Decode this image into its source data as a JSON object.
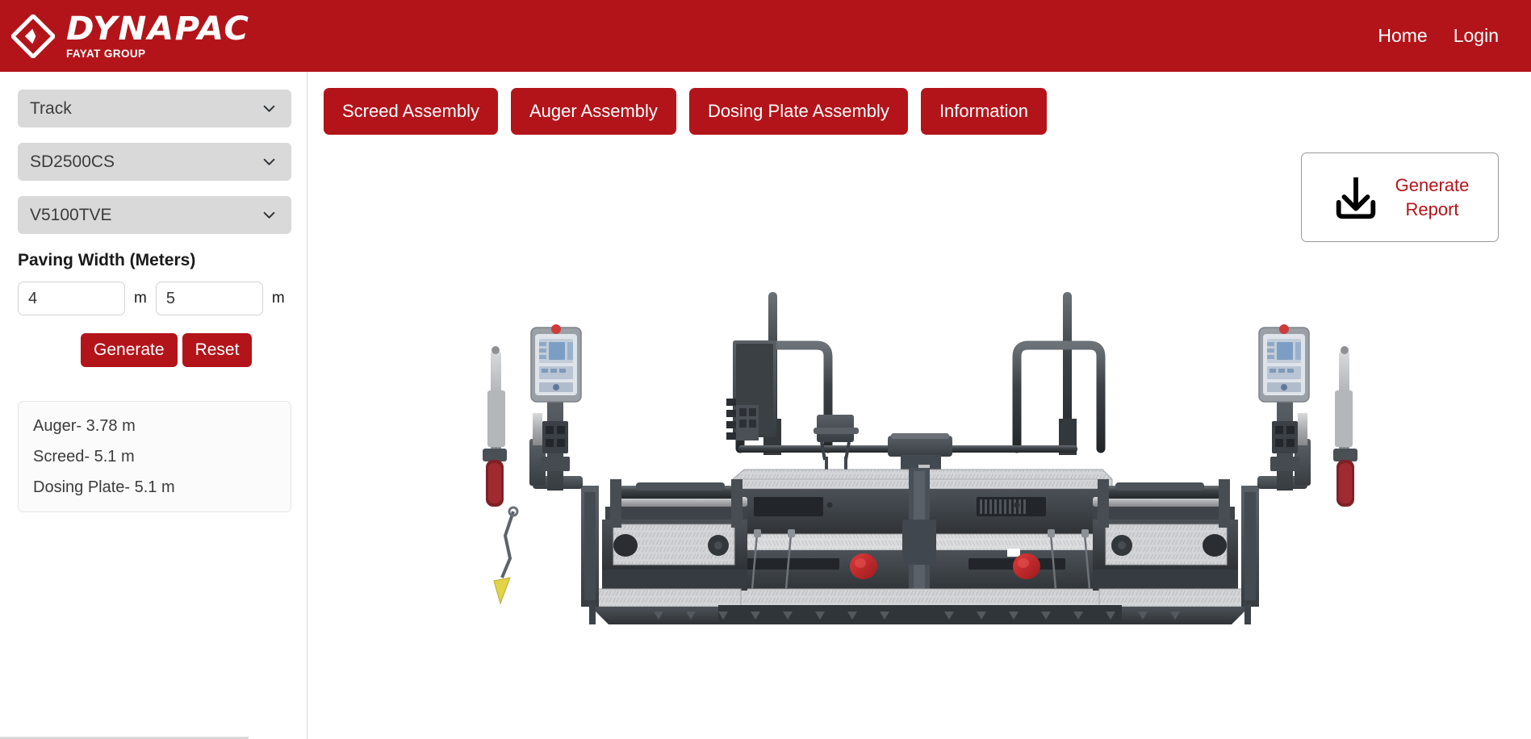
{
  "header": {
    "brand_name": "DYNAPAC",
    "brand_sub": "FAYAT GROUP",
    "brand_icon": "dynapac-diamond-logo",
    "nav": [
      {
        "label": "Home",
        "name": "nav-home"
      },
      {
        "label": "Login",
        "name": "nav-login"
      }
    ],
    "background_color": "#b3141a"
  },
  "sidebar": {
    "selects": [
      {
        "name": "machine-type-select",
        "value": "Track",
        "icon": "chevron-down-icon"
      },
      {
        "name": "machine-model-select",
        "value": "SD2500CS",
        "icon": "chevron-down-icon"
      },
      {
        "name": "screed-model-select",
        "value": "V5100TVE",
        "icon": "chevron-down-icon"
      }
    ],
    "paving_width": {
      "label": "Paving Width (Meters)",
      "left_value": "4",
      "left_unit": "m",
      "right_value": "5",
      "right_unit": "m",
      "placeholder": ""
    },
    "actions": {
      "generate_label": "Generate",
      "reset_label": "Reset"
    },
    "results": [
      "Auger- 3.78 m",
      "Screed- 5.1 m",
      "Dosing Plate- 5.1 m"
    ]
  },
  "main": {
    "tabs": [
      {
        "label": "Screed Assembly",
        "name": "tab-screed-assembly"
      },
      {
        "label": "Auger Assembly",
        "name": "tab-auger-assembly"
      },
      {
        "label": "Dosing Plate Assembly",
        "name": "tab-dosing-plate-assembly"
      },
      {
        "label": "Information",
        "name": "tab-information"
      }
    ],
    "report_button": {
      "label": "Generate\nReport",
      "icon": "download-icon",
      "text_color": "#b3141a"
    },
    "viewer": {
      "alt": "Dynapac SD2500CS paver screed assembly front view render"
    }
  },
  "colors": {
    "brand_red": "#b3141a",
    "select_grey": "#d9d9d9",
    "card_grey": "#fbfbfb",
    "machine_dark": "#3a3f44",
    "machine_plate": "#d5d6d8",
    "machine_accent_red": "#c6262c"
  }
}
